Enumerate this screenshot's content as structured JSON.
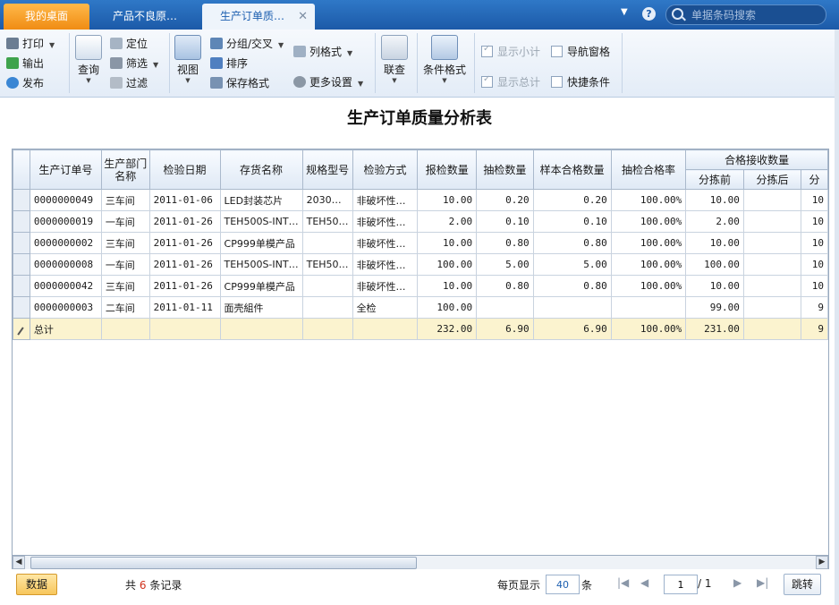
{
  "tabs": {
    "home": "我的桌面",
    "second": "产品不良原…",
    "active": "生产订单质…"
  },
  "search": {
    "placeholder": "单据条码搜索"
  },
  "ribbon": {
    "print": "打印",
    "export": "输出",
    "publish": "发布",
    "query": "查询",
    "locate": "定位",
    "filter": "筛选",
    "filter2": "过滤",
    "view": "视图",
    "group_cross": "分组/交叉",
    "sort": "排序",
    "save_format": "保存格式",
    "column_format": "列格式",
    "more_settings": "更多设置",
    "link_query": "联查",
    "cond_format": "条件格式",
    "show_subtotal": "显示小计",
    "show_total": "显示总计",
    "nav_pane": "导航窗格",
    "quick_cond": "快捷条件"
  },
  "report": {
    "title": "生产订单质量分析表",
    "columns": [
      "生产订单号",
      "生产部门名称",
      "检验日期",
      "存货名称",
      "规格型号",
      "检验方式",
      "报检数量",
      "抽检数量",
      "样本合格数量",
      "抽检合格率",
      "合格接收数量"
    ],
    "sub_columns": [
      "分拣前",
      "分拣后",
      "分"
    ],
    "rows": [
      [
        "0000000049",
        "三车间",
        "2011-01-06",
        "LED封装芯片",
        "2030…",
        "非破坏性…",
        "10.00",
        "0.20",
        "0.20",
        "100.00%",
        "10.00",
        "",
        "10"
      ],
      [
        "0000000019",
        "一车间",
        "2011-01-26",
        "TEH500S-INT…",
        "TEH50…",
        "非破坏性…",
        "2.00",
        "0.10",
        "0.10",
        "100.00%",
        "2.00",
        "",
        "10"
      ],
      [
        "0000000002",
        "三车间",
        "2011-01-26",
        "CP999单模产品",
        "",
        "非破坏性…",
        "10.00",
        "0.80",
        "0.80",
        "100.00%",
        "10.00",
        "",
        "10"
      ],
      [
        "0000000008",
        "一车间",
        "2011-01-26",
        "TEH500S-INT…",
        "TEH50…",
        "非破坏性…",
        "100.00",
        "5.00",
        "5.00",
        "100.00%",
        "100.00",
        "",
        "10"
      ],
      [
        "0000000042",
        "三车间",
        "2011-01-26",
        "CP999单模产品",
        "",
        "非破坏性…",
        "10.00",
        "0.80",
        "0.80",
        "100.00%",
        "10.00",
        "",
        "10"
      ],
      [
        "0000000003",
        "二车间",
        "2011-01-11",
        "面壳組件",
        "",
        "全检",
        "100.00",
        "",
        "",
        "",
        "99.00",
        "",
        "9"
      ]
    ],
    "total": [
      "总计",
      "",
      "",
      "",
      "",
      "",
      "232.00",
      "6.90",
      "6.90",
      "100.00%",
      "231.00",
      "",
      "9"
    ]
  },
  "status": {
    "data_btn": "数据",
    "record_prefix": "共",
    "record_count": "6",
    "record_suffix": "条记录",
    "page_size_label": "每页显示",
    "page_size": "40",
    "page_size_unit": "条",
    "page_current": "1",
    "page_total": "/ 1",
    "jump": "跳转"
  },
  "colors": {
    "accent": "#1c5aa8",
    "home_tab": "#f08c13",
    "total_row": "#fbf3cf"
  }
}
